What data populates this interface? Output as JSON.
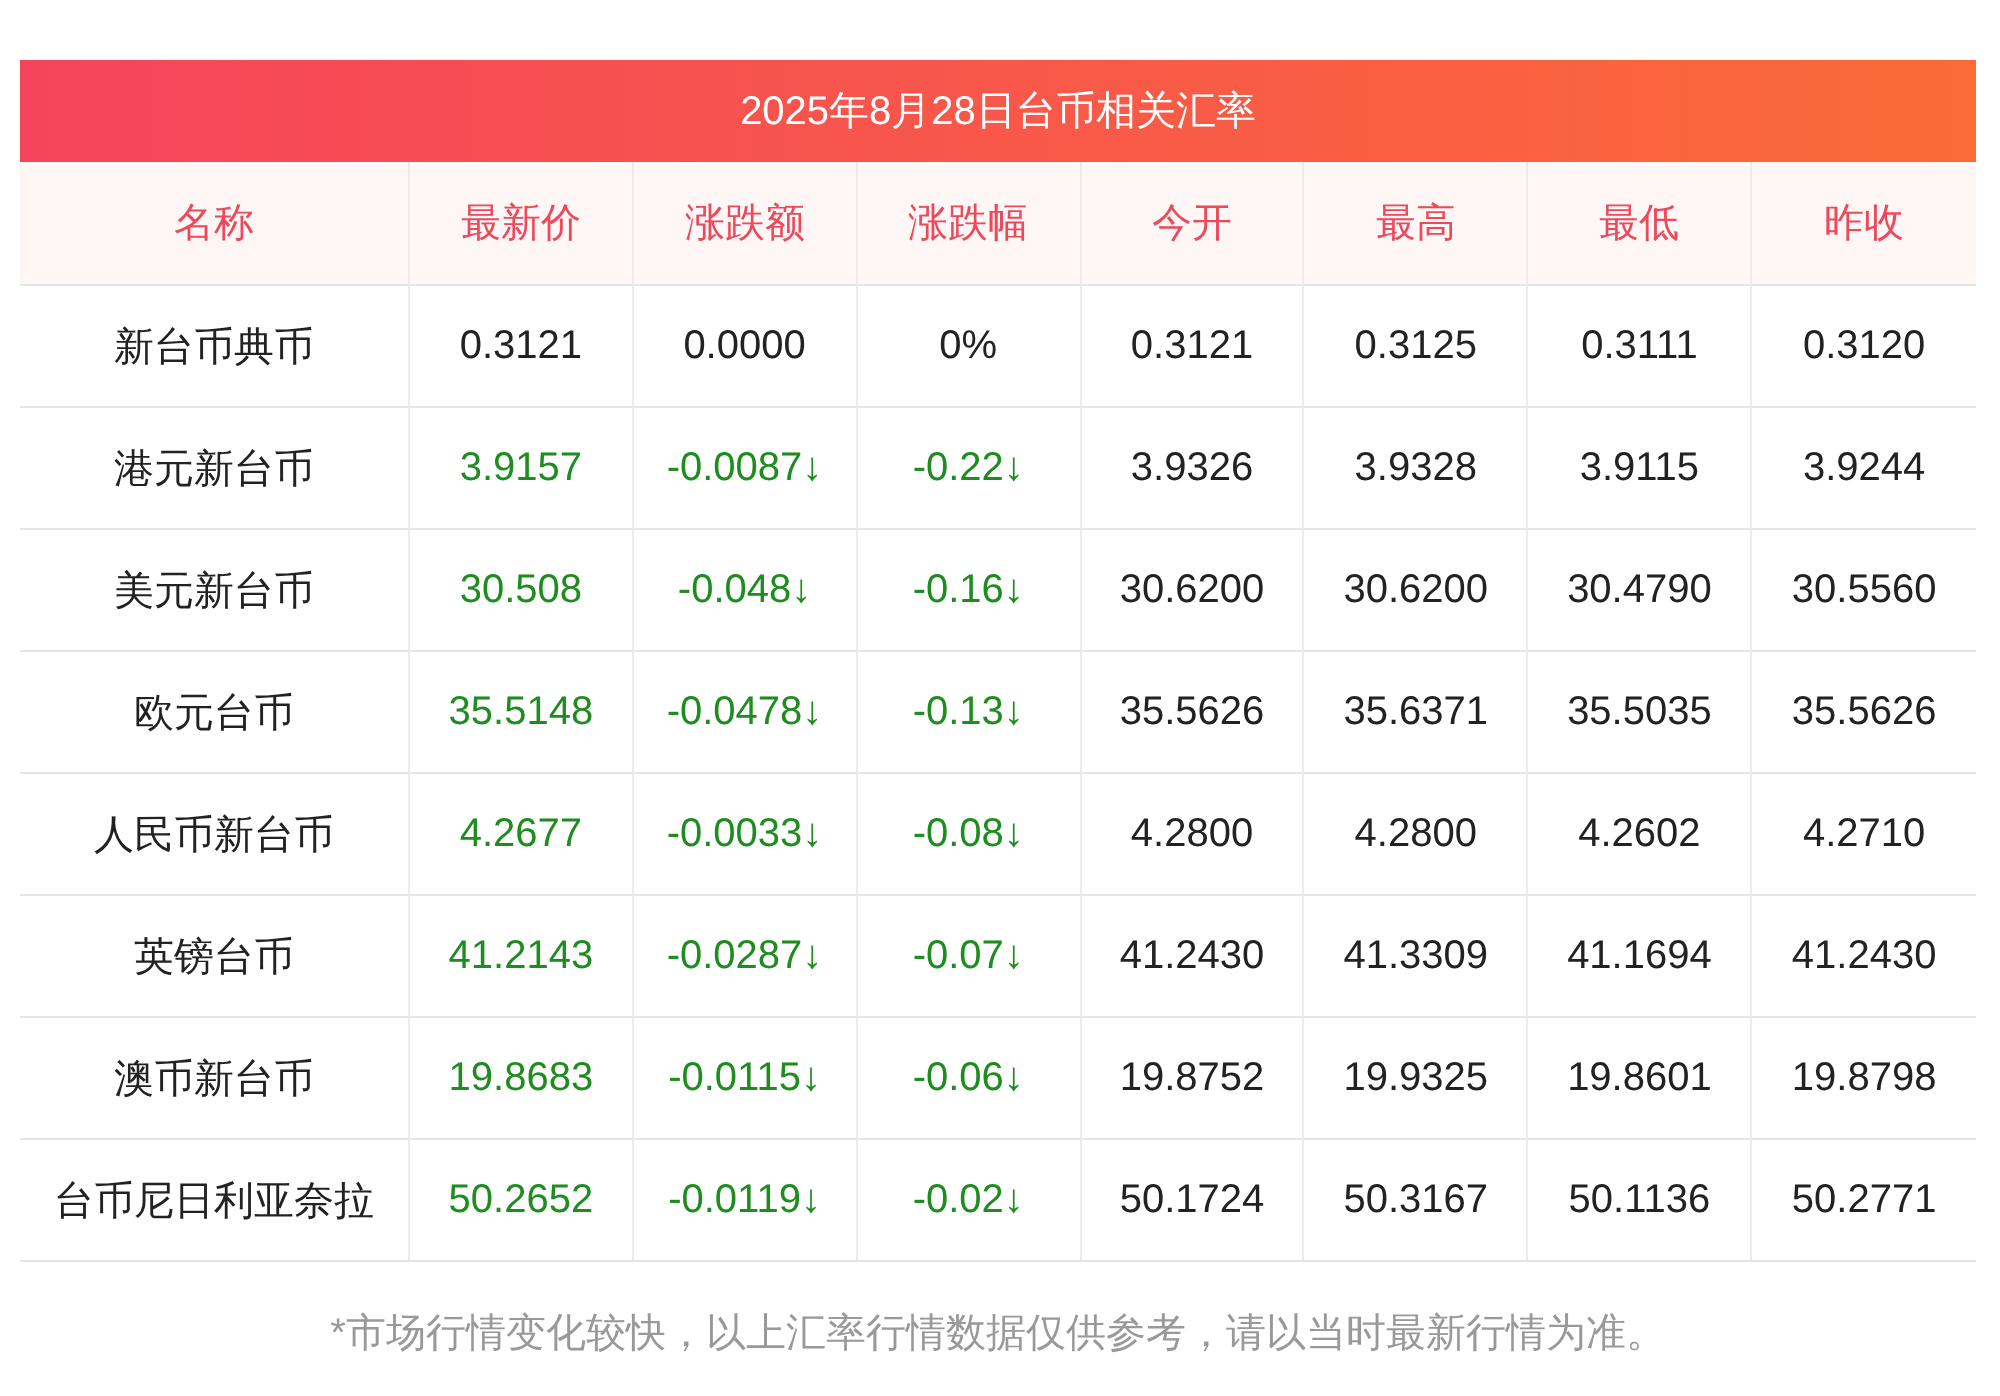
{
  "title": "2025年8月28日台币相关汇率",
  "columns": [
    "名称",
    "最新价",
    "涨跌额",
    "涨跌幅",
    "今开",
    "最高",
    "最低",
    "昨收"
  ],
  "rows": [
    {
      "falling": false,
      "cells": [
        "新台币典币",
        "0.3121",
        "0.0000",
        "0%",
        "0.3121",
        "0.3125",
        "0.3111",
        "0.3120"
      ]
    },
    {
      "falling": true,
      "cells": [
        "港元新台币",
        "3.9157",
        "-0.0087↓",
        "-0.22↓",
        "3.9326",
        "3.9328",
        "3.9115",
        "3.9244"
      ]
    },
    {
      "falling": true,
      "cells": [
        "美元新台币",
        "30.508",
        "-0.048↓",
        "-0.16↓",
        "30.6200",
        "30.6200",
        "30.4790",
        "30.5560"
      ]
    },
    {
      "falling": true,
      "cells": [
        "欧元台币",
        "35.5148",
        "-0.0478↓",
        "-0.13↓",
        "35.5626",
        "35.6371",
        "35.5035",
        "35.5626"
      ]
    },
    {
      "falling": true,
      "cells": [
        "人民币新台币",
        "4.2677",
        "-0.0033↓",
        "-0.08↓",
        "4.2800",
        "4.2800",
        "4.2602",
        "4.2710"
      ]
    },
    {
      "falling": true,
      "cells": [
        "英镑台币",
        "41.2143",
        "-0.0287↓",
        "-0.07↓",
        "41.2430",
        "41.3309",
        "41.1694",
        "41.2430"
      ]
    },
    {
      "falling": true,
      "cells": [
        "澳币新台币",
        "19.8683",
        "-0.0115↓",
        "-0.06↓",
        "19.8752",
        "19.9325",
        "19.8601",
        "19.8798"
      ]
    },
    {
      "falling": true,
      "cells": [
        "台币尼日利亚奈拉",
        "50.2652",
        "-0.0119↓",
        "-0.02↓",
        "50.1724",
        "50.3167",
        "50.1136",
        "50.2771"
      ]
    }
  ],
  "note": "*市场行情变化较快，以上汇率行情数据仅供参考，请以当时最新行情为准。"
}
